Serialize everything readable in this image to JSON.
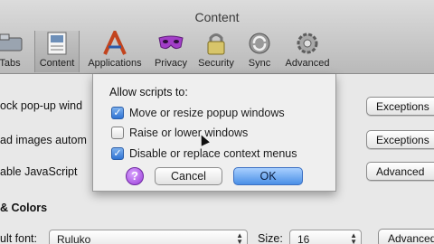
{
  "window": {
    "title": "Content"
  },
  "toolbar": {
    "items": [
      {
        "label": "Tabs",
        "icon": "tabs-icon"
      },
      {
        "label": "Content",
        "icon": "content-icon"
      },
      {
        "label": "Applications",
        "icon": "applications-icon"
      },
      {
        "label": "Privacy",
        "icon": "privacy-mask-icon"
      },
      {
        "label": "Security",
        "icon": "lock-icon"
      },
      {
        "label": "Sync",
        "icon": "sync-icon"
      },
      {
        "label": "Advanced",
        "icon": "gear-icon"
      }
    ]
  },
  "pane": {
    "rows": [
      {
        "text": "ock pop-up wind",
        "button": "Exceptions"
      },
      {
        "text": "ad images autom",
        "button": "Exceptions"
      },
      {
        "text": "able JavaScript",
        "button": "Advanced"
      }
    ],
    "fonts_heading": "& Colors",
    "default_font_label": "ult font:",
    "default_font_value": "Ruluko",
    "size_label": "Size:",
    "size_value": "16",
    "fonts_advanced_button": "Advanced"
  },
  "sheet": {
    "heading": "Allow scripts to:",
    "options": [
      {
        "label": "Move or resize popup windows",
        "checked": true
      },
      {
        "label": "Raise or lower windows",
        "checked": false
      },
      {
        "label": "Disable or replace context menus",
        "checked": true
      }
    ],
    "help": "?",
    "cancel": "Cancel",
    "ok": "OK"
  }
}
